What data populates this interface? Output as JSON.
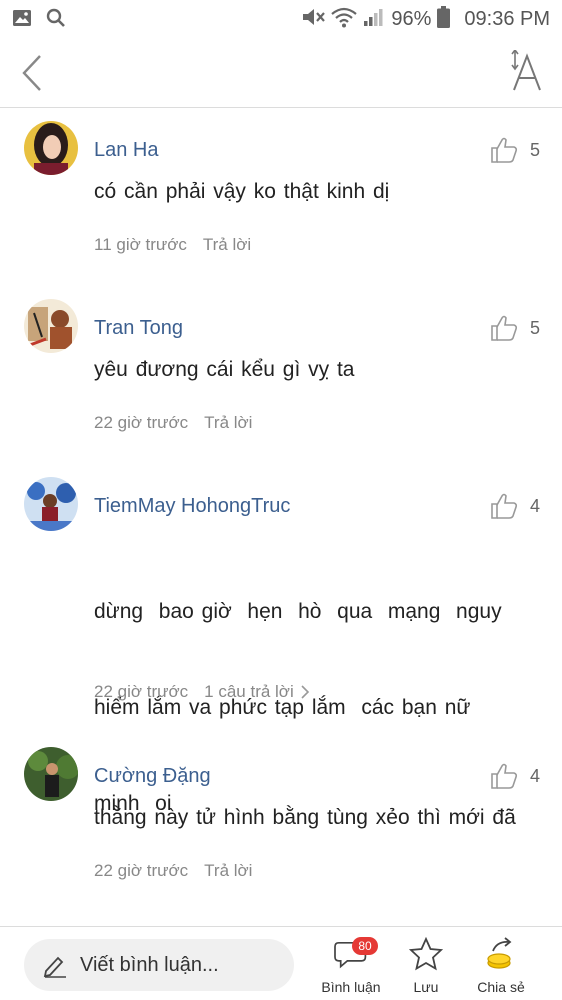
{
  "status_bar": {
    "battery": "96%",
    "time": "09:36 PM",
    "icons": [
      "image-icon",
      "search-icon",
      "mute-icon",
      "wifi-icon",
      "signal-icon",
      "battery-icon"
    ]
  },
  "header": {
    "back_icon": "chevron-left-icon",
    "font_icon": "font-size-icon"
  },
  "comments": [
    {
      "name": "Lan Ha",
      "likes": "5",
      "text": "có cần phải vậy ko thật kinh dị",
      "time": "11 giờ trước",
      "reply": "Trả lời"
    },
    {
      "name": "Tran Tong",
      "likes": "5",
      "text": "yêu đương cái kểu gì vỵ ta",
      "time": "22 giờ trước",
      "reply": "Trả lời"
    },
    {
      "name": "TiemMay HohongTruc",
      "likes": "4",
      "text_lines": [
        "dừng  bao giờ  hẹn  hò  qua  mạng  nguy",
        "hiểm lắm va phức tạp lắm  các bạn nữ",
        "minh  oi"
      ],
      "time": "22 giờ trước",
      "replies": "1 câu trả lời"
    },
    {
      "name": "Cường Đặng",
      "likes": "4",
      "text": "thằng này tử hình bằng tùng xẻo thì mới đã",
      "time": "22 giờ trước",
      "reply": "Trả lời"
    }
  ],
  "bottom_bar": {
    "write_placeholder": "Viết bình luận...",
    "comments_label": "Bình luận",
    "comments_badge": "80",
    "save_label": "Lưu",
    "share_label": "Chia sẻ"
  },
  "colors": {
    "username": "#3c5f8f",
    "badge": "#e53935",
    "meta_text": "#888888"
  }
}
